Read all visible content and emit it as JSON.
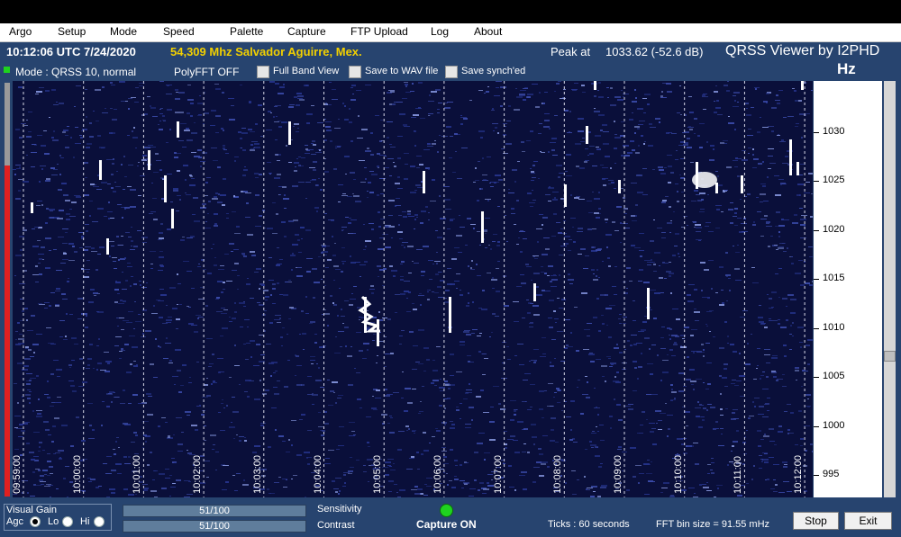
{
  "menu": [
    "Argo",
    "Setup",
    "Mode",
    "Speed",
    "Palette",
    "Capture",
    "FTP Upload",
    "Log",
    "About"
  ],
  "status": {
    "datetime": "10:12:06 UTC  7/24/2020",
    "station": "54,309 Mhz Salvador Aguirre, Mex.",
    "peak_label": "Peak at",
    "peak_value": "1033.62 (-52.6 dB)",
    "app_title": "QRSS Viewer by I2PHD",
    "unit": "Hz"
  },
  "modebar": {
    "mode": "Mode : QRSS 10, normal",
    "polyfft": "PolyFFT OFF",
    "full_band": "Full Band View",
    "save_wav": "Save to WAV file",
    "save_synch": "Save synch'ed"
  },
  "freq_ticks": [
    "1030",
    "1025",
    "1020",
    "1015",
    "1010",
    "1005",
    "1000",
    "995"
  ],
  "time_ticks": [
    "09:59:00",
    "10:00:00",
    "10:01:00",
    "10:02:00",
    "10:03:00",
    "10:04:00",
    "10:05:00",
    "10:06:00",
    "10:07:00",
    "10:08:00",
    "10:09:00",
    "10:10:00",
    "10:11:00",
    "10:12:00"
  ],
  "bottom": {
    "visual_gain": "Visual Gain",
    "agc": "Agc",
    "lo": "Lo",
    "hi": "Hi",
    "sensitivity_value": "51/100",
    "sensitivity_label": "Sensitivity",
    "contrast_value": "51/100",
    "contrast_label": "Contrast",
    "capture": "Capture ON",
    "ticks": "Ticks  :  60 seconds",
    "fft_bin": "FFT bin size = 91.55 mHz",
    "stop": "Stop",
    "exit": "Exit"
  },
  "colors": {
    "panel": "#27446f",
    "waterfall_bg": "#0a0f3a",
    "station_text": "#f2d000",
    "capture_led": "#1fd21f"
  }
}
